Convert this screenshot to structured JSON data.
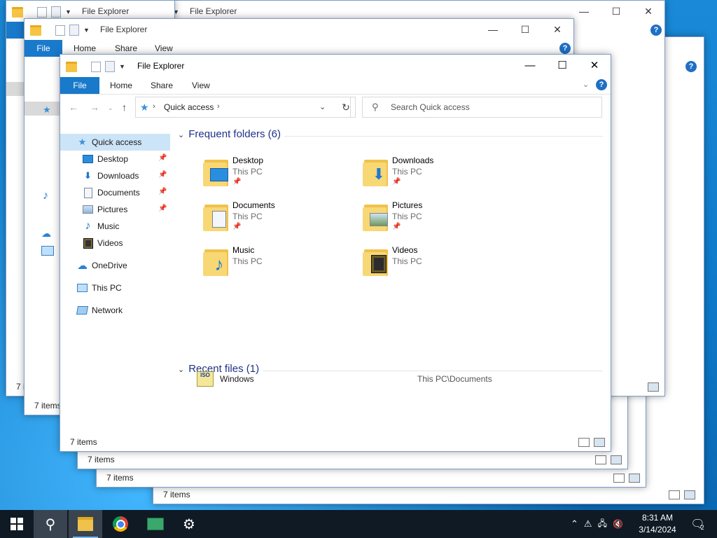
{
  "window": {
    "title": "File Explorer",
    "ribbon": {
      "file": "File",
      "home": "Home",
      "share": "Share",
      "view": "View"
    },
    "controls": {
      "minimize": "—",
      "maximize": "☐",
      "close": "✕"
    },
    "help": "?"
  },
  "address": {
    "path": "Quick access",
    "search_placeholder": "Search Quick access"
  },
  "nav": {
    "quick_access": "Quick access",
    "items": [
      {
        "label": "Desktop",
        "pinned": true,
        "icon": "desktop-icon"
      },
      {
        "label": "Downloads",
        "pinned": true,
        "icon": "downloads-icon"
      },
      {
        "label": "Documents",
        "pinned": true,
        "icon": "documents-icon"
      },
      {
        "label": "Pictures",
        "pinned": true,
        "icon": "pictures-icon"
      },
      {
        "label": "Music",
        "pinned": false,
        "icon": "music-icon"
      },
      {
        "label": "Videos",
        "pinned": false,
        "icon": "videos-icon"
      }
    ],
    "onedrive": "OneDrive",
    "this_pc": "This PC",
    "network": "Network"
  },
  "frequent": {
    "header": "Frequent folders (6)",
    "folders": [
      {
        "name": "Desktop",
        "location": "This PC",
        "pinned": true
      },
      {
        "name": "Downloads",
        "location": "This PC",
        "pinned": true
      },
      {
        "name": "Documents",
        "location": "This PC",
        "pinned": true
      },
      {
        "name": "Pictures",
        "location": "This PC",
        "pinned": true
      },
      {
        "name": "Music",
        "location": "This PC",
        "pinned": false
      },
      {
        "name": "Videos",
        "location": "This PC",
        "pinned": false
      }
    ]
  },
  "recent": {
    "header": "Recent files (1)",
    "files": [
      {
        "name": "Windows",
        "path": "This PC\\Documents",
        "badge": "ISO"
      }
    ]
  },
  "status": {
    "count": "7 items"
  },
  "taskbar": {
    "time": "8:31 AM",
    "date": "3/14/2024",
    "notification_count": "2"
  },
  "colors": {
    "accent": "#1979ca",
    "selection": "#cce4f7",
    "heading": "#1e3287",
    "taskbar": "#101a24"
  }
}
